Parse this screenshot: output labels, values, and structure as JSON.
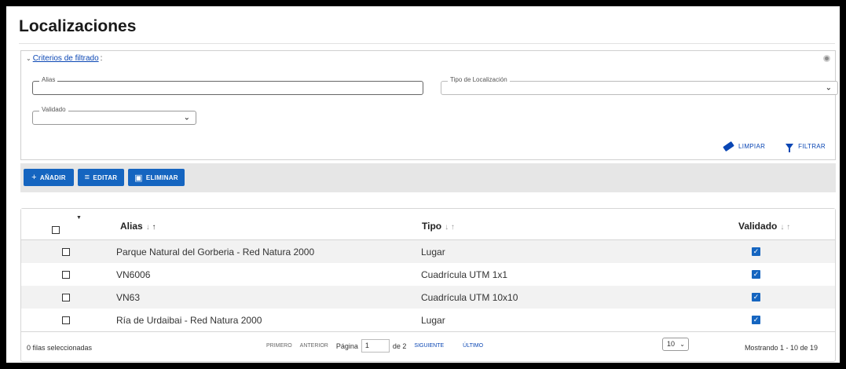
{
  "page": {
    "title": "Localizaciones"
  },
  "filter": {
    "header_link": "Criterios de filtrado",
    "header_suffix": ":",
    "alias_label": "Alias",
    "tipo_label": "Tipo de Localización",
    "validado_label": "Validado",
    "clear_label": "LIMPIAR",
    "filter_label": "FILTRAR"
  },
  "toolbar": {
    "add_label": "AÑADIR",
    "edit_label": "EDITAR",
    "delete_label": "ELIMINAR"
  },
  "table": {
    "columns": [
      "Alias",
      "Tipo",
      "Validado"
    ],
    "rows": [
      {
        "alias": "Parque Natural del Gorberia - Red Natura 2000",
        "tipo": "Lugar",
        "validado": true
      },
      {
        "alias": "VN6006",
        "tipo": "Cuadrícula UTM 1x1",
        "validado": true
      },
      {
        "alias": "VN63",
        "tipo": "Cuadrícula UTM 10x10",
        "validado": true
      },
      {
        "alias": "Ría de Urdaibai - Red Natura 2000",
        "tipo": "Lugar",
        "validado": true
      }
    ]
  },
  "footer": {
    "selected_text": "0 filas seleccionadas",
    "first_label": "PRIMERO",
    "prev_label": "ANTERIOR",
    "page_label": "Página",
    "page_value": "1",
    "of_text": "de 2",
    "next_label": "SIGUIENTE",
    "last_label": "ÚLTIMO",
    "page_size": "10",
    "showing_text": "Mostrando 1 - 10 de 19"
  },
  "colors": {
    "primary": "#1565c0",
    "link": "#0a46b4",
    "toolbar_bg": "#e6e6e6",
    "row_alt": "#f2f2f2"
  },
  "icons": [
    "chevron-down-icon",
    "eraser-icon",
    "funnel-icon",
    "plus-icon",
    "edit-icon",
    "trash-icon",
    "sort-arrows-icon",
    "checkbox-checked-icon"
  ]
}
